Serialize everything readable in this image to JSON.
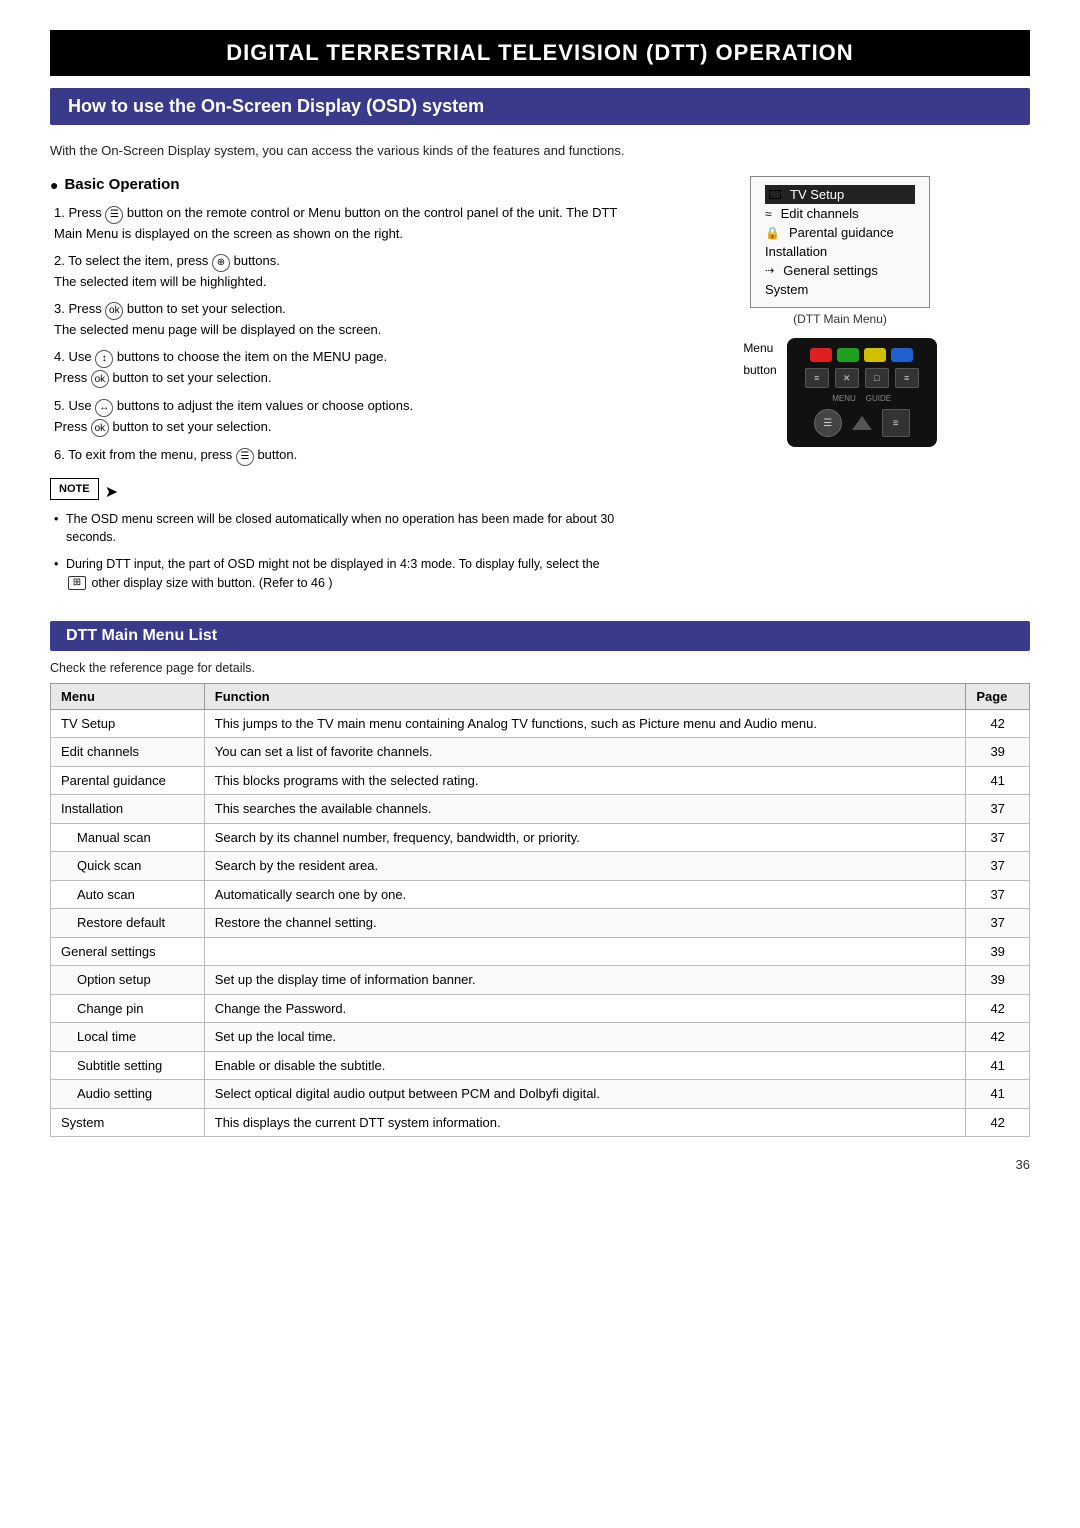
{
  "page": {
    "main_title": "DIGITAL TERRESTRIAL TELEVISION (DTT) OPERATION",
    "sub_title": "How to use the On-Screen Display (OSD) system",
    "intro_text": "With the On-Screen Display system, you can access the various kinds of the features and functions.",
    "basic_operation": {
      "heading": "Basic Operation",
      "steps": [
        {
          "num": "1.",
          "text": "Press  button on the remote control or Menu button on the control panel of the unit. The DTT Main Menu  is displayed on the screen as shown on the right."
        },
        {
          "num": "2.",
          "text": "To select the item, press  buttons.\nThe selected item will be highlighted."
        },
        {
          "num": "3.",
          "text": "Press  button to set your selection.\nThe selected menu page will be displayed on the screen."
        },
        {
          "num": "4.",
          "text": "Use  buttons to choose the item on the MENU page.\nPress  button to set your selection."
        },
        {
          "num": "5.",
          "text": "Use  buttons to adjust the item values or choose options.\nPress  button to set your selection."
        },
        {
          "num": "6.",
          "text": "To exit from the menu, press  button."
        }
      ],
      "note_label": "NOTE",
      "notes": [
        "The OSD menu screen will be closed automatically when no operation has been made for about 30 seconds.",
        "During DTT input, the part of OSD might not be displayed in 4:3 mode. To display fully, select the  other display size with button. (Refer to  46 )"
      ]
    },
    "osd_menu": {
      "caption": "(DTT Main Menu)",
      "items": [
        {
          "label": "TV Setup",
          "selected": true,
          "icon": "tv"
        },
        {
          "label": "Edit channels",
          "selected": false,
          "icon": "wave"
        },
        {
          "label": "Parental guidance",
          "selected": false,
          "icon": "lock"
        },
        {
          "label": "Installation",
          "selected": false,
          "icon": ""
        },
        {
          "label": "General settings",
          "selected": false,
          "icon": "wrench"
        },
        {
          "label": "System",
          "selected": false,
          "icon": ""
        }
      ]
    },
    "remote": {
      "menu_label": "Menu",
      "button_label": "button",
      "colors": [
        "#e02020",
        "#20a020",
        "#d0c000",
        "#2060d0"
      ],
      "icon_labels": [
        "≡",
        "✕",
        "□",
        "≡"
      ],
      "menu_text": "MENU",
      "guide_text": "GUIDE"
    },
    "dtt_section": {
      "heading": "DTT Main Menu List",
      "check_ref": "Check the reference page for details.",
      "col_menu": "Menu",
      "col_function": "Function",
      "col_page": "Page",
      "rows": [
        {
          "menu": "TV Setup",
          "indent": false,
          "function": "This jumps to the TV main menu containing Analog TV functions, such as Picture menu and Audio menu.",
          "page": "42"
        },
        {
          "menu": "Edit channels",
          "indent": false,
          "function": "You can set a list of favorite channels.",
          "page": "39"
        },
        {
          "menu": "Parental guidance",
          "indent": false,
          "function": "This blocks programs with the selected rating.",
          "page": "41"
        },
        {
          "menu": "Installation",
          "indent": false,
          "function": "This searches the available channels.",
          "page": "37"
        },
        {
          "menu": "Manual scan",
          "indent": true,
          "function": "Search by its channel number, frequency, bandwidth, or priority.",
          "page": "37"
        },
        {
          "menu": "Quick scan",
          "indent": true,
          "function": "Search by the resident area.",
          "page": "37"
        },
        {
          "menu": "Auto scan",
          "indent": true,
          "function": "Automatically search one by one.",
          "page": "37"
        },
        {
          "menu": "Restore default",
          "indent": true,
          "function": "Restore the channel setting.",
          "page": "37"
        },
        {
          "menu": "General settings",
          "indent": false,
          "function": "",
          "page": "39"
        },
        {
          "menu": "Option setup",
          "indent": true,
          "function": "Set up the display time of information banner.",
          "page": "39"
        },
        {
          "menu": "Change pin",
          "indent": true,
          "function": "Change the Password.",
          "page": "42"
        },
        {
          "menu": "Local time",
          "indent": true,
          "function": "Set up the local time.",
          "page": "42"
        },
        {
          "menu": "Subtitle setting",
          "indent": true,
          "function": "Enable or disable the subtitle.",
          "page": "41"
        },
        {
          "menu": "Audio setting",
          "indent": true,
          "function": "Select optical digital audio output between PCM and Dolbyfi digital.",
          "page": "41"
        },
        {
          "menu": "System",
          "indent": false,
          "function": "This displays the current DTT system information.",
          "page": "42"
        }
      ]
    },
    "page_number": "36"
  }
}
